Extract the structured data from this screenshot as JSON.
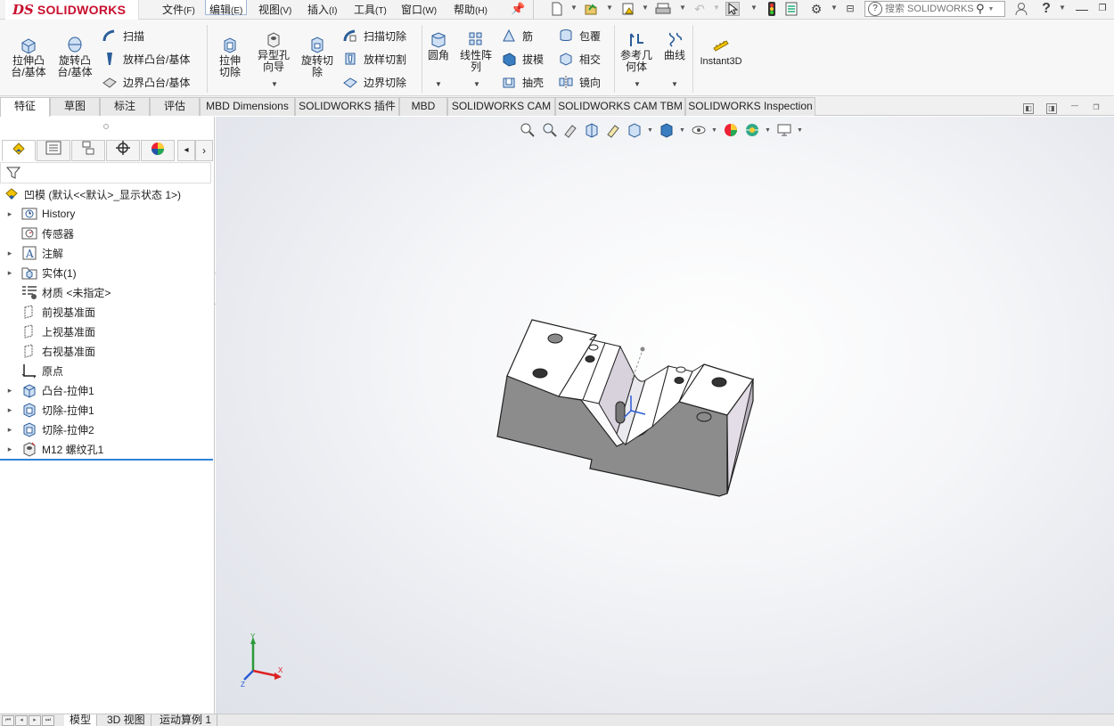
{
  "app": {
    "logo_ds": "DS",
    "logo_name": "SOLIDWORKS"
  },
  "menu": [
    {
      "label": "文件",
      "key": "(F)"
    },
    {
      "label": "编辑",
      "key": "(E)"
    },
    {
      "label": "视图",
      "key": "(V)"
    },
    {
      "label": "插入",
      "key": "(I)"
    },
    {
      "label": "工具",
      "key": "(T)"
    },
    {
      "label": "窗口",
      "key": "(W)"
    },
    {
      "label": "帮助",
      "key": "(H)"
    }
  ],
  "search": {
    "placeholder": "搜索 SOLIDWORKS"
  },
  "ribbon": {
    "extrude_boss": "拉伸凸台/基体",
    "revolve_boss": "旋转凸台/基体",
    "sweep": "扫描",
    "loft_boss": "放样凸台/基体",
    "boundary_boss": "边界凸台/基体",
    "extrude_cut": "拉伸切除",
    "hole_wizard": "异型孔向导",
    "revolve_cut": "旋转切除",
    "sweep_cut": "扫描切除",
    "loft_cut": "放样切割",
    "boundary_cut": "边界切除",
    "fillet": "圆角",
    "linear_pattern": "线性阵列",
    "rib": "筋",
    "draft": "拔模",
    "shell": "抽壳",
    "wrap": "包覆",
    "intersect": "相交",
    "mirror": "镜向",
    "ref_geometry": "参考几何体",
    "curves": "曲线",
    "instant3d": "Instant3D"
  },
  "tabs": [
    "特征",
    "草图",
    "标注",
    "评估",
    "MBD Dimensions",
    "SOLIDWORKS 插件",
    "MBD",
    "SOLIDWORKS CAM",
    "SOLIDWORKS CAM TBM",
    "SOLIDWORKS Inspection"
  ],
  "tree": {
    "root": "凹模 (默认<<默认>_显示状态 1>)",
    "items": [
      {
        "label": "History",
        "icon": "history-icon",
        "expandable": true
      },
      {
        "label": "传感器",
        "icon": "sensor-icon",
        "expandable": false
      },
      {
        "label": "注解",
        "icon": "annotation-icon",
        "expandable": true
      },
      {
        "label": "实体(1)",
        "icon": "solid-bodies-icon",
        "expandable": true
      },
      {
        "label": "材质 <未指定>",
        "icon": "material-icon",
        "expandable": false
      },
      {
        "label": "前视基准面",
        "icon": "plane-icon",
        "expandable": false
      },
      {
        "label": "上视基准面",
        "icon": "plane-icon",
        "expandable": false
      },
      {
        "label": "右视基准面",
        "icon": "plane-icon",
        "expandable": false
      },
      {
        "label": "原点",
        "icon": "origin-icon",
        "expandable": false
      },
      {
        "label": "凸台-拉伸1",
        "icon": "extrude-feature-icon",
        "expandable": true
      },
      {
        "label": "切除-拉伸1",
        "icon": "cut-feature-icon",
        "expandable": true
      },
      {
        "label": "切除-拉伸2",
        "icon": "cut-feature-icon",
        "expandable": true
      },
      {
        "label": "M12 螺纹孔1",
        "icon": "hole-feature-icon",
        "expandable": true
      }
    ]
  },
  "bottom_tabs": [
    "模型",
    "3D 视图",
    "运动算例 1"
  ],
  "triad": {
    "x": "X",
    "y": "Y",
    "z": "Z"
  },
  "colors": {
    "accent": "#2f85d8",
    "brand": "#c8102e",
    "model_face": "#ffffff",
    "model_side": "#8c8c8c"
  }
}
